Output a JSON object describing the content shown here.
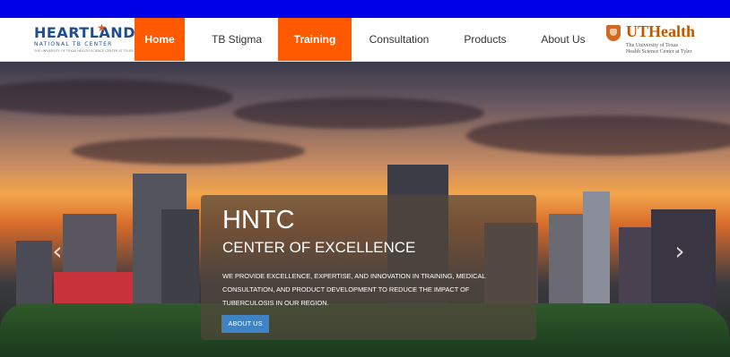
{
  "brand": {
    "name": "HEARTLAND",
    "subtitle": "NATIONAL TB CENTER",
    "tagline": "THE UNIVERSITY OF TEXAS HEALTH SCIENCE CENTER AT TYLER"
  },
  "nav": {
    "items": [
      {
        "label": "Home",
        "active": true
      },
      {
        "label": "TB Stigma",
        "active": false
      },
      {
        "label": "Training",
        "active": true
      },
      {
        "label": "Consultation",
        "active": false
      },
      {
        "label": "Products",
        "active": false
      },
      {
        "label": "About Us",
        "active": false
      }
    ]
  },
  "partner": {
    "name": "UTHealth",
    "line1": "The University of Texas",
    "line2": "Health Science Center at Tyler"
  },
  "hero": {
    "title": "HNTC",
    "subtitle": "CENTER OF EXCELLENCE",
    "body": "WE PROVIDE EXCELLENCE, EXPERTISE, AND INNOVATION IN TRAINING, MEDICAL CONSULTATION, AND PRODUCT DEVELOPMENT TO REDUCE THE IMPACT OF TUBERCULOSIS IN OUR REGION.",
    "button": "ABOUT US",
    "prev_icon": "chevron-left-icon",
    "next_icon": "chevron-right-icon"
  },
  "colors": {
    "topbar": "#0000e6",
    "accent": "#ff5a00",
    "brand": "#1f4e8c",
    "partner": "#bf5700",
    "button": "#3f83c4"
  }
}
